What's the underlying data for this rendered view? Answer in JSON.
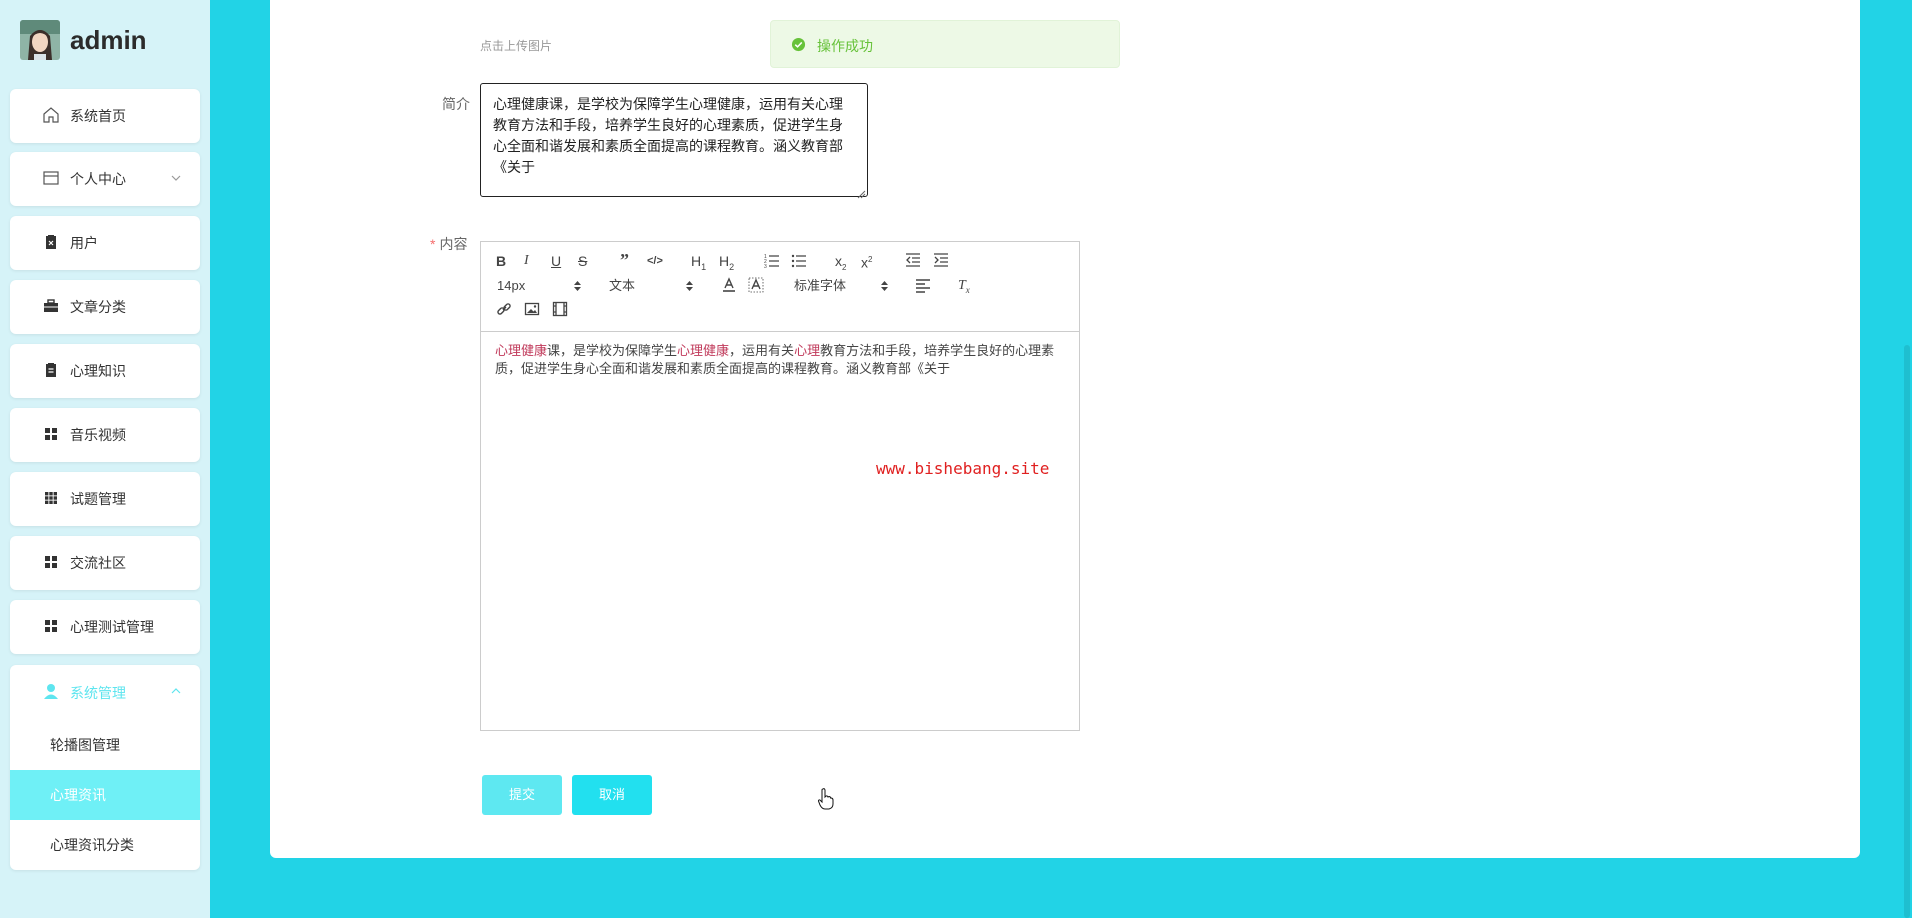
{
  "brand": {
    "name": "admin"
  },
  "sidebar": {
    "items": [
      {
        "label": "系统首页",
        "icon": "home-icon"
      },
      {
        "label": "个人中心",
        "icon": "card-icon",
        "has_chevron": true
      },
      {
        "label": "用户",
        "icon": "clipboard-x-icon"
      },
      {
        "label": "文章分类",
        "icon": "briefcase-icon"
      },
      {
        "label": "心理知识",
        "icon": "clipboard-icon"
      },
      {
        "label": "音乐视频",
        "icon": "grid-icon"
      },
      {
        "label": "试题管理",
        "icon": "grid-9-icon"
      },
      {
        "label": "交流社区",
        "icon": "grid-icon"
      },
      {
        "label": "心理测试管理",
        "icon": "grid-icon"
      }
    ],
    "system": {
      "label": "系统管理",
      "icon": "user-icon",
      "sub_items": [
        {
          "label": "轮播图管理",
          "active": false
        },
        {
          "label": "心理资讯",
          "active": true
        },
        {
          "label": "心理资讯分类",
          "active": false
        }
      ]
    }
  },
  "form": {
    "upload_hint": "点击上传图片",
    "toast": "操作成功",
    "intro_label": "简介",
    "intro_value": "心理健康课，是学校为保障学生心理健康，运用有关心理教育方法和手段，培养学生良好的心理素质，促进学生身心全面和谐发展和素质全面提高的课程教育。涵义教育部《关于",
    "content_label": "内容",
    "content_required": "*",
    "editor": {
      "font_size": "14px",
      "text_type": "文本",
      "font_family": "标准字体",
      "body_parts": [
        {
          "text": "心理健康",
          "hl": true
        },
        {
          "text": "课，是学校为保障学生",
          "hl": false
        },
        {
          "text": "心理健康",
          "hl": true
        },
        {
          "text": "，运用有关",
          "hl": false
        },
        {
          "text": "心理",
          "hl": true
        },
        {
          "text": "教育方法和手段，培养学生良好的心理素质，促进学生身心全面和谐发展和素质全面提高的课程教育。涵义教育部《关于",
          "hl": false
        }
      ]
    },
    "submit_label": "提交",
    "cancel_label": "取消"
  },
  "watermark": "www.bishebang.site",
  "colors": {
    "accent": "#22d3e6",
    "button": "#22e0ef",
    "active_item": "#6ff0f6",
    "success": "#67c23a"
  }
}
